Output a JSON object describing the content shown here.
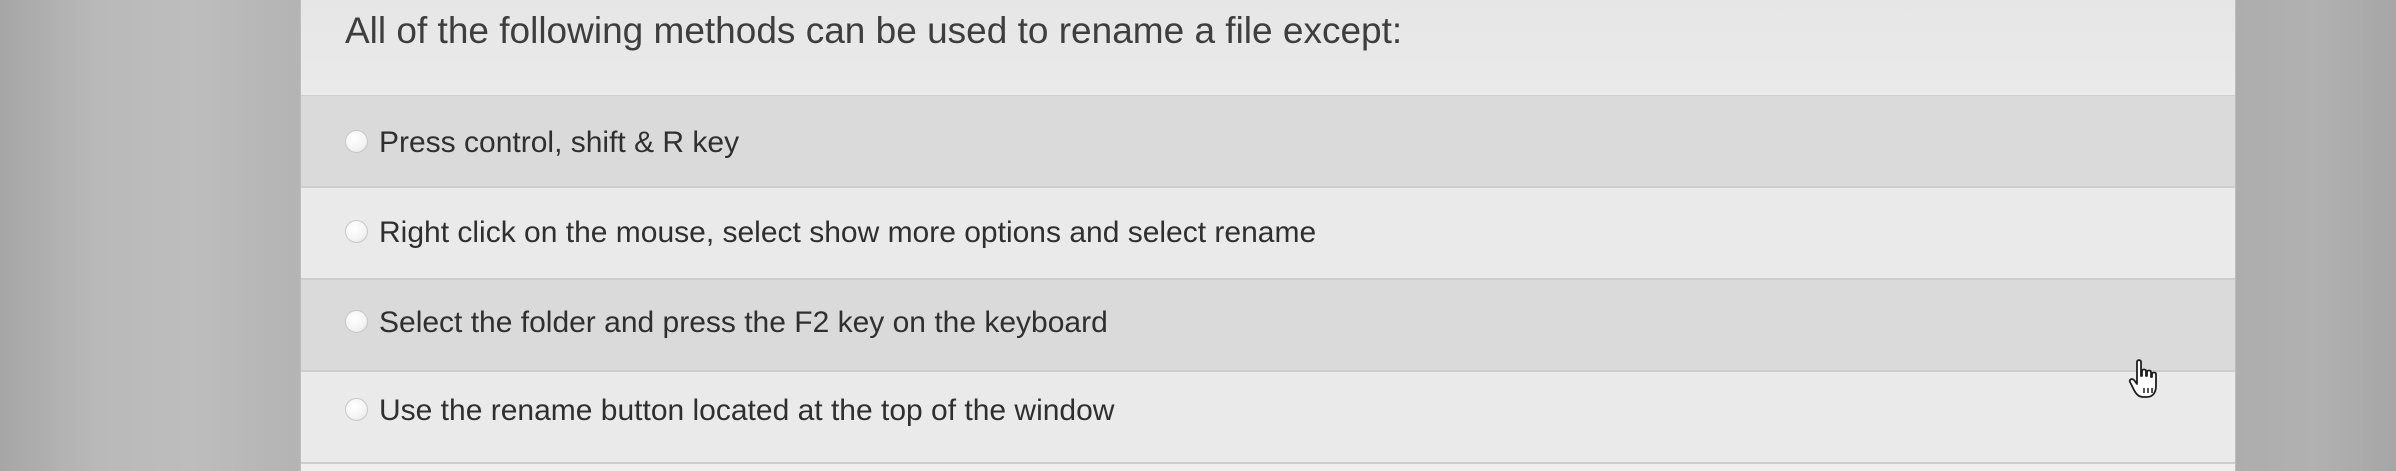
{
  "quiz": {
    "question": "All of the following methods can be used to rename a file except:",
    "options": [
      {
        "label": "Press control, shift & R key"
      },
      {
        "label": "Right click on the mouse, select show more options and select rename"
      },
      {
        "label": "Select the folder and press the F2 key on the keyboard"
      },
      {
        "label": "Use the rename button located at the top of the window"
      }
    ]
  },
  "icons": {
    "option_marker": "radio-button-icon",
    "pointer": "hand-cursor-icon"
  },
  "colors": {
    "card_background": "#efefef",
    "shaded_row": "#dadada",
    "plain_row": "#eaeaea",
    "text": "#2f2f2f"
  }
}
